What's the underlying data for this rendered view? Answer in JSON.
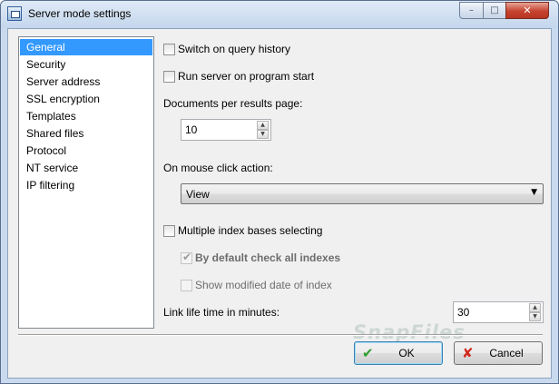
{
  "window": {
    "title": "Server mode settings",
    "controls": {
      "minimize": "–",
      "maximize": "□",
      "close": "✕"
    }
  },
  "nav": {
    "items": [
      {
        "label": "General",
        "selected": true
      },
      {
        "label": "Security",
        "selected": false
      },
      {
        "label": "Server address",
        "selected": false
      },
      {
        "label": "SSL encryption",
        "selected": false
      },
      {
        "label": "Templates",
        "selected": false
      },
      {
        "label": "Shared files",
        "selected": false
      },
      {
        "label": "Protocol",
        "selected": false
      },
      {
        "label": "NT service",
        "selected": false
      },
      {
        "label": "IP filtering",
        "selected": false
      }
    ]
  },
  "general": {
    "query_history": {
      "label": "Switch on query history",
      "checked": false,
      "enabled": true
    },
    "run_on_start": {
      "label": "Run server on program start",
      "checked": false,
      "enabled": true
    },
    "docs_per_page": {
      "label": "Documents per results page:",
      "value": "10"
    },
    "mouse_click": {
      "label": "On mouse click action:",
      "value": "View"
    },
    "multiple_index": {
      "label": "Multiple index bases selecting",
      "checked": false,
      "enabled": true
    },
    "check_all_indexes": {
      "label": "By default check all indexes",
      "checked": true,
      "enabled": false
    },
    "show_modified_date": {
      "label": "Show modified date of index",
      "checked": false,
      "enabled": false
    },
    "link_life": {
      "label": "Link life time in minutes:",
      "value": "30"
    }
  },
  "footer": {
    "ok_label": "OK",
    "cancel_label": "Cancel"
  },
  "watermark": "SnapFiles",
  "colors": {
    "selection": "#3399ff",
    "client_bg": "#f0f0f0",
    "frame": "#c9daee",
    "close_button": "#c5432f"
  }
}
